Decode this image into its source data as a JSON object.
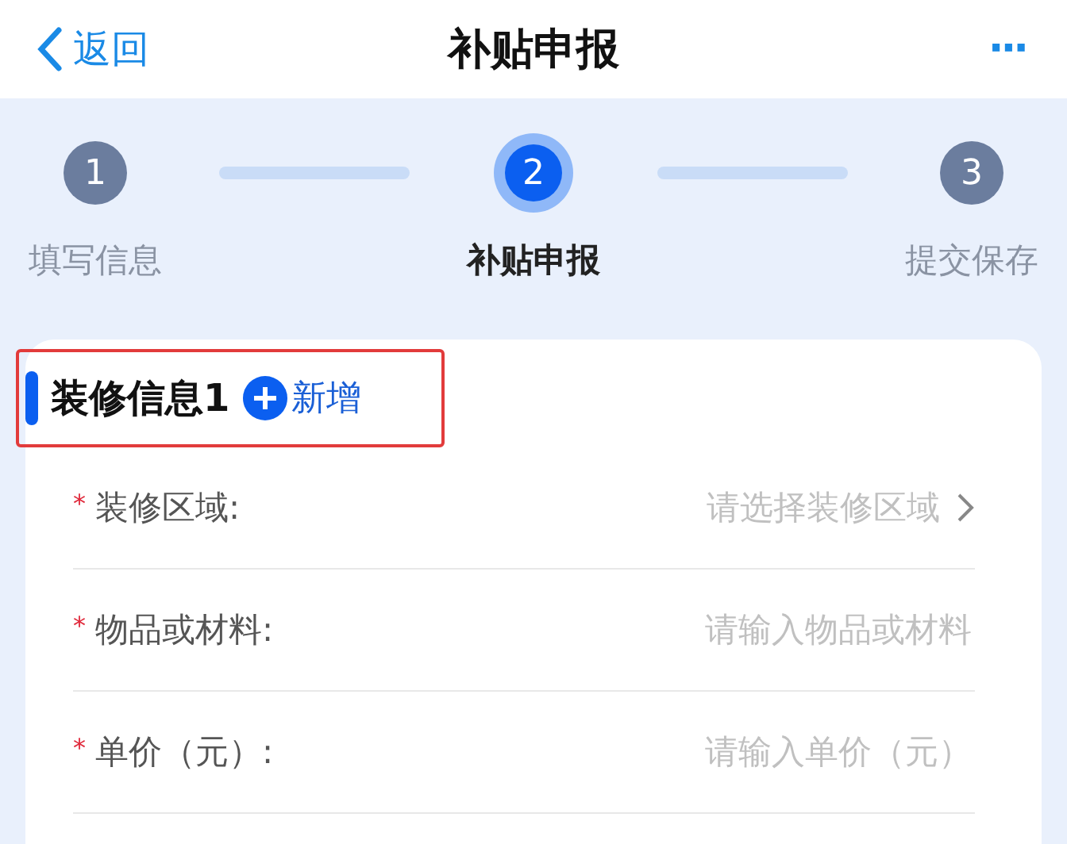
{
  "nav": {
    "back": "返回",
    "title": "补贴申报",
    "more": "···"
  },
  "steps": [
    {
      "number": "1",
      "label": "填写信息",
      "selected": false
    },
    {
      "number": "2",
      "label": "补贴申报",
      "selected": true
    },
    {
      "number": "3",
      "label": "提交保存",
      "selected": false
    }
  ],
  "section": {
    "title": "装修信息1",
    "add": "新增",
    "highlighted": true,
    "fields": [
      {
        "kind": "select",
        "label": "装修区域:",
        "placeholder": "请选择装修区域",
        "required": true,
        "mark": "*"
      },
      {
        "kind": "input",
        "label": "物品或材料:",
        "placeholder": "请输入物品或材料",
        "required": true,
        "mark": "*"
      },
      {
        "kind": "input",
        "label": "单价（元）:",
        "placeholder": "请输入单价（元）",
        "required": true,
        "mark": "*"
      }
    ]
  }
}
